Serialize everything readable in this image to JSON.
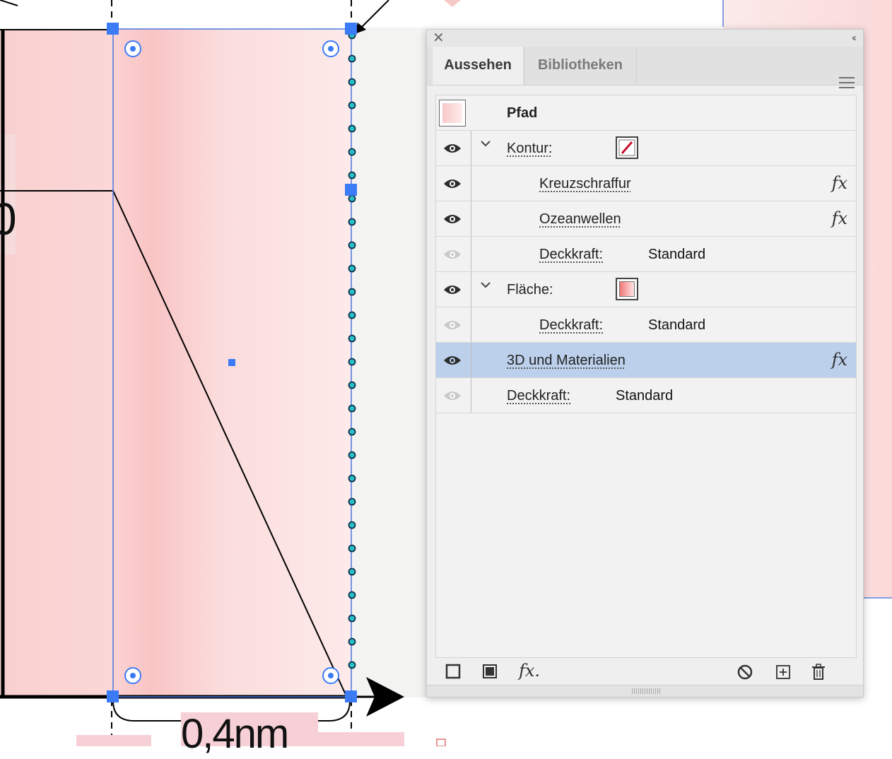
{
  "canvas": {
    "dimension_label": "0,4nm",
    "partial_label": "0"
  },
  "panel": {
    "close_icon": "✕",
    "collapse_icon": "‹‹",
    "tabs": [
      {
        "label": "Aussehen",
        "active": true
      },
      {
        "label": "Bibliotheken",
        "active": false
      }
    ],
    "object_title": "Pfad",
    "rows": [
      {
        "label": "Kontur:",
        "swatch": "stroke-none"
      },
      {
        "label": "Kreuzschraffur",
        "fx": "fx"
      },
      {
        "label": "Ozeanwellen",
        "fx": "fx"
      },
      {
        "label": "Deckkraft:",
        "value": "Standard"
      },
      {
        "label": "Fläche:",
        "swatch": "gradient"
      },
      {
        "label": "Deckkraft:",
        "value": "Standard"
      },
      {
        "label": "3D und Materialien",
        "fx": "fx",
        "selected": true
      },
      {
        "label": "Deckkraft:",
        "value": "Standard"
      }
    ],
    "bottom_fx_label": "fx.",
    "colors": {
      "selection_blue": "#3b7bf5",
      "row_selected": "#bcd0ec",
      "stroke_none_red": "#c8102e",
      "fill_pink": "#f8c8c8"
    }
  }
}
